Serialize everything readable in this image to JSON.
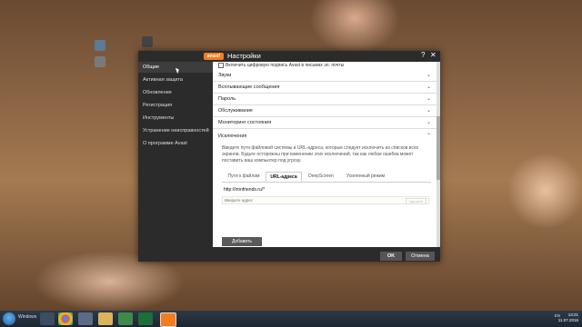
{
  "window": {
    "title": "Настройки",
    "logo_text": "avast!",
    "help_label": "?",
    "close_label": "✕"
  },
  "sidebar": {
    "items": [
      {
        "label": "Общие"
      },
      {
        "label": "Активная защита"
      },
      {
        "label": "Обновление"
      },
      {
        "label": "Регистрация"
      },
      {
        "label": "Инструменты"
      },
      {
        "label": "Устранение неисправностей"
      },
      {
        "label": "О программе Avast"
      }
    ],
    "active_index": 0
  },
  "content": {
    "top_checkbox_label": "Включить цифровую подпись Avast в письмах эл. почты",
    "sections": [
      {
        "label": "Звуки",
        "expanded": false
      },
      {
        "label": "Всплывающие сообщения",
        "expanded": false
      },
      {
        "label": "Пароль",
        "expanded": false
      },
      {
        "label": "Обслуживание",
        "expanded": false
      },
      {
        "label": "Мониторинг состояния",
        "expanded": false
      },
      {
        "label": "Исключения",
        "expanded": true
      }
    ],
    "exclusions": {
      "description": "Введите пути файловой системы и URL-адреса, которые следует исключить из списков всех экранов. Будьте осторожны при изменении этих исключений, так как любая ошибка может поставить ваш компьютер под угрозу.",
      "tabs": [
        {
          "label": "Пути к файлам",
          "active": false
        },
        {
          "label": "URL-адреса",
          "active": true
        },
        {
          "label": "DeepScreen",
          "active": false
        },
        {
          "label": "Усиленный режим",
          "active": false
        }
      ],
      "url_entry": "http://ironfriends.ru/*",
      "input_placeholder": "Введите адрес",
      "delete_label": "Удалить",
      "add_label": "Добавить"
    }
  },
  "footer": {
    "ok_label": "OK",
    "cancel_label": "Отмена"
  },
  "taskbar": {
    "start_label": "Windows",
    "tray_language": "EN",
    "time": "13:21",
    "date": "11.07.2016"
  },
  "colors": {
    "window_dark": "#2b2b2b",
    "sidebar_active": "#3d3d3d",
    "avast_orange": "#f47d20",
    "button_gray": "#555555"
  }
}
